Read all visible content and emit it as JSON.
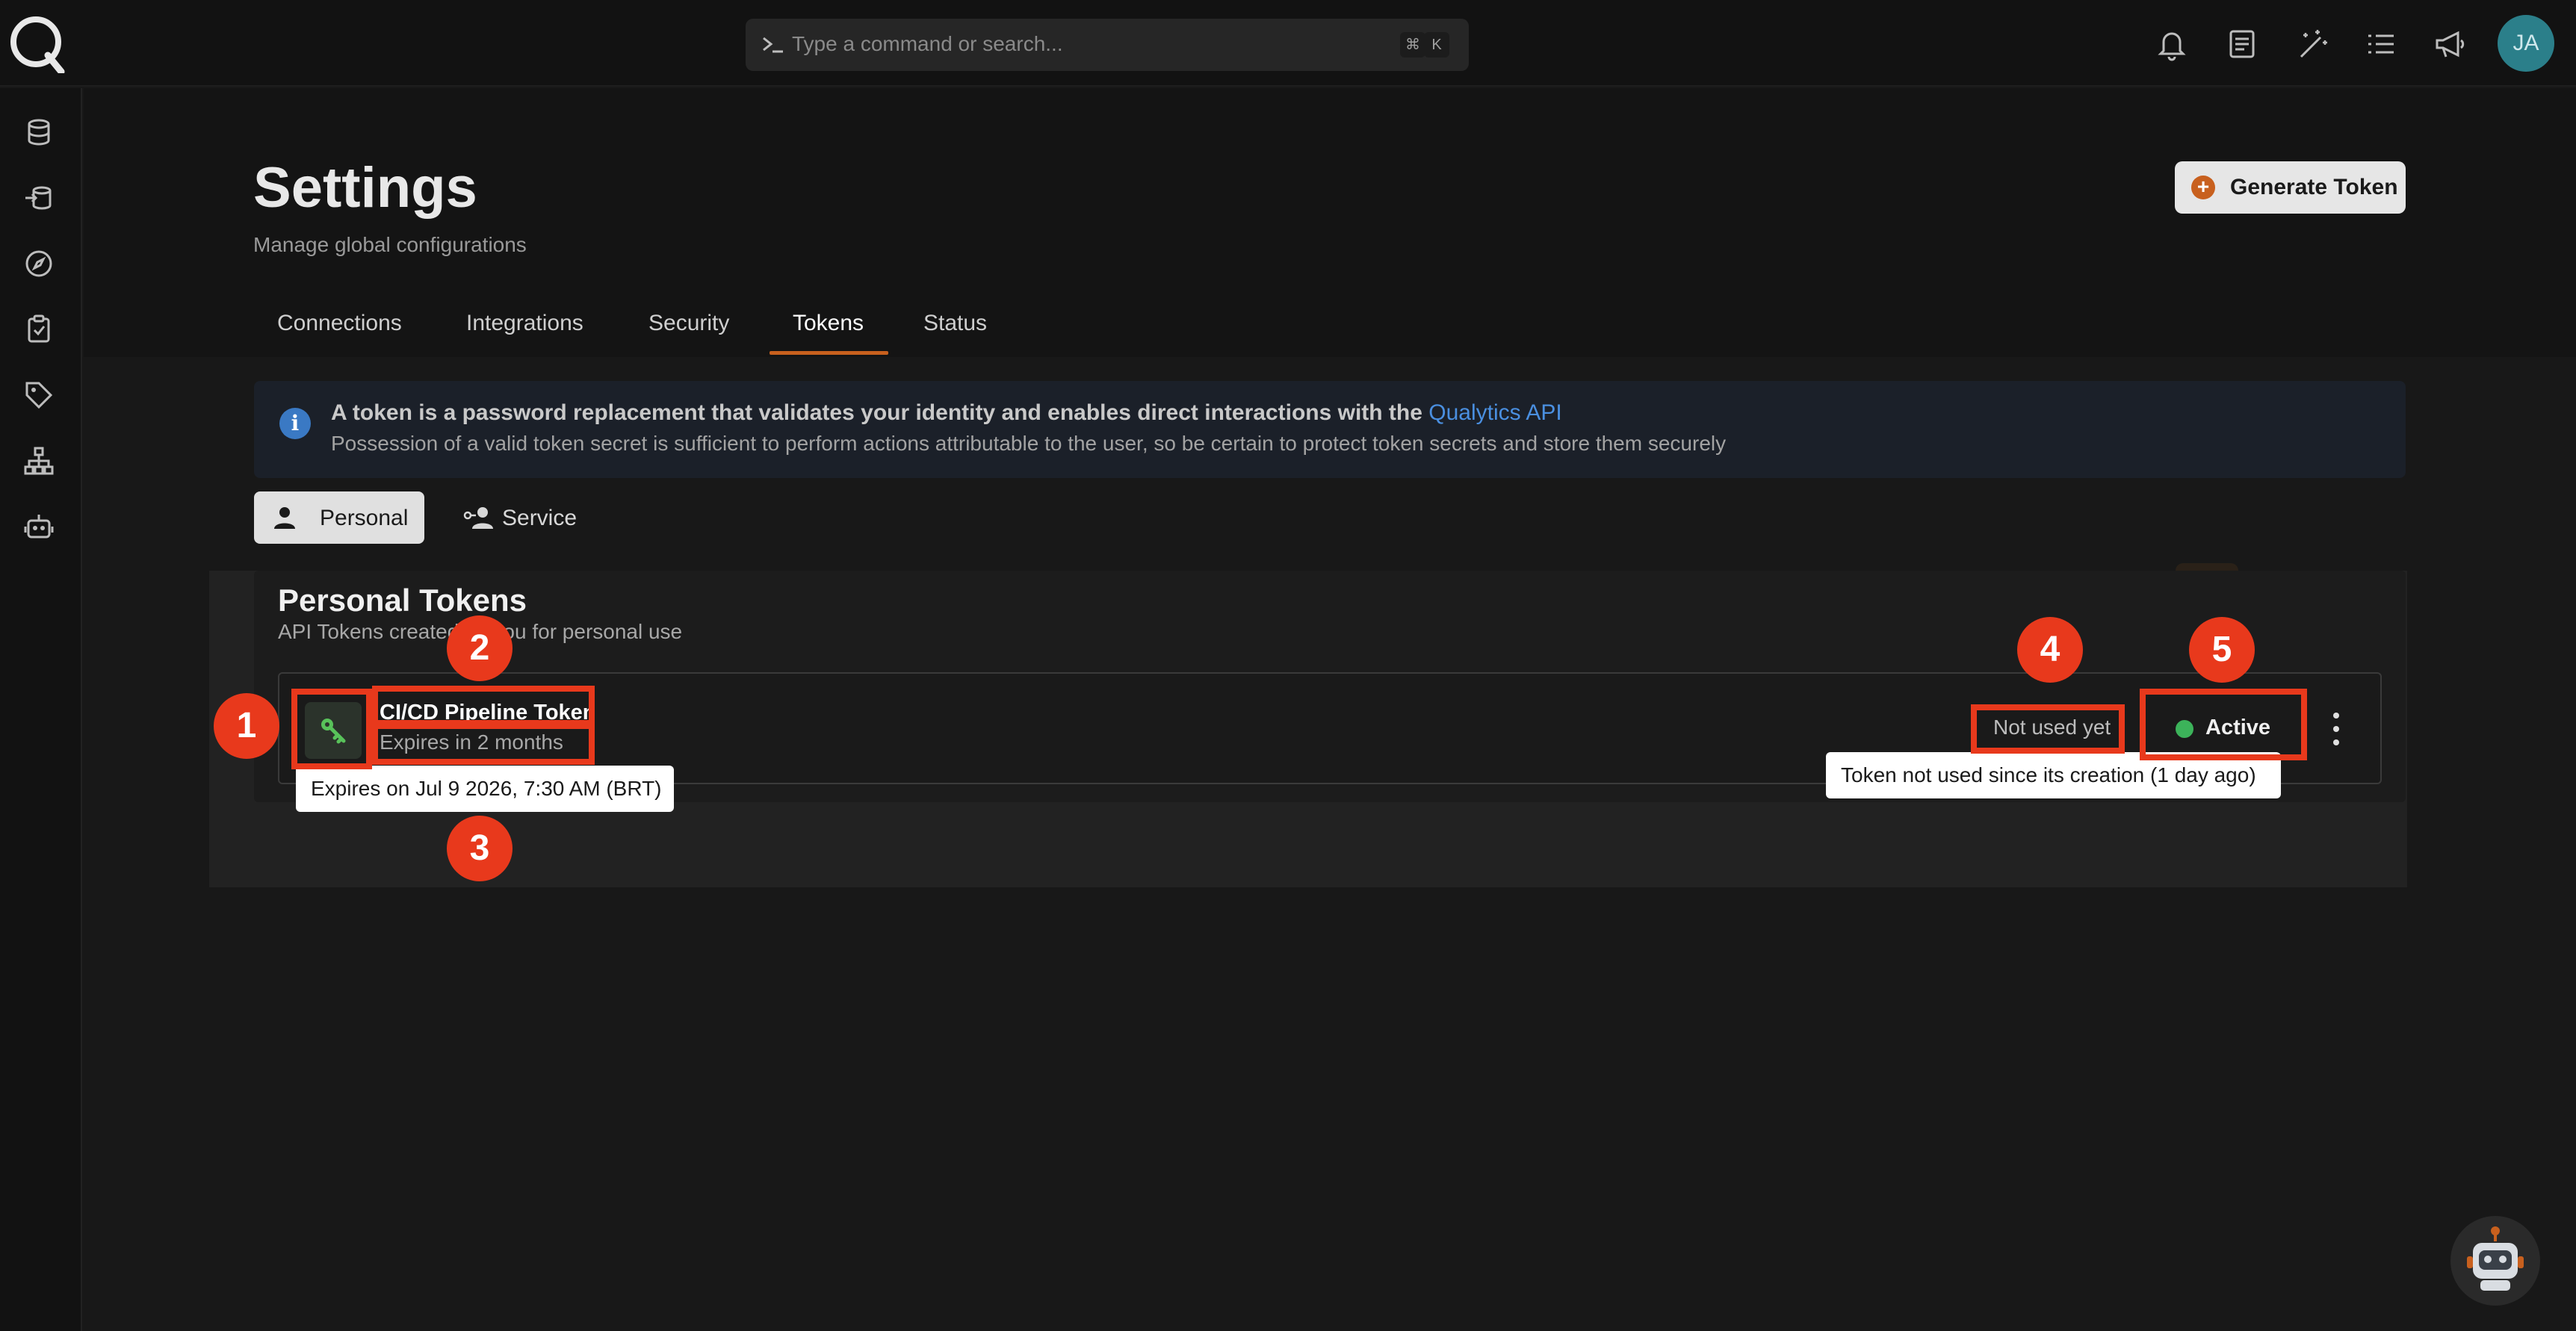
{
  "command_bar": {
    "placeholder": "Type a command or search...",
    "shortcut_mod": "⌘",
    "shortcut_key": "K"
  },
  "user": {
    "initials": "JA"
  },
  "header": {
    "title": "Settings",
    "subtitle": "Manage global configurations",
    "generate_button": "Generate Token"
  },
  "tabs": [
    {
      "label": "Connections"
    },
    {
      "label": "Integrations"
    },
    {
      "label": "Security"
    },
    {
      "label": "Tokens",
      "active": true
    },
    {
      "label": "Status"
    }
  ],
  "info": {
    "line1": "A token is a password replacement that validates your identity and enables direct interactions with the",
    "link": "Qualytics API",
    "line2": "Possession of a valid token secret is sufficient to perform actions attributable to the user, so be certain to protect token secrets and store them securely"
  },
  "subtabs": {
    "personal": "Personal",
    "service": "Service"
  },
  "card": {
    "title": "Personal Tokens",
    "subtitle": "API Tokens created by you for personal use",
    "token": {
      "name": "CI/CD Pipeline Token",
      "expires": "Expires in 2 months",
      "usage": "Not used yet",
      "status": "Active"
    }
  },
  "tooltips": {
    "expiry": "Expires on Jul 9 2026, 7:30 AM (BRT)",
    "usage": "Token not used since its creation (1 day ago)"
  },
  "annotations": [
    "1",
    "2",
    "3",
    "4",
    "5"
  ],
  "colors": {
    "accent": "#c8601e",
    "annotation": "#e8391c",
    "status_active": "#3cb35a",
    "link": "#4a8fe0"
  }
}
